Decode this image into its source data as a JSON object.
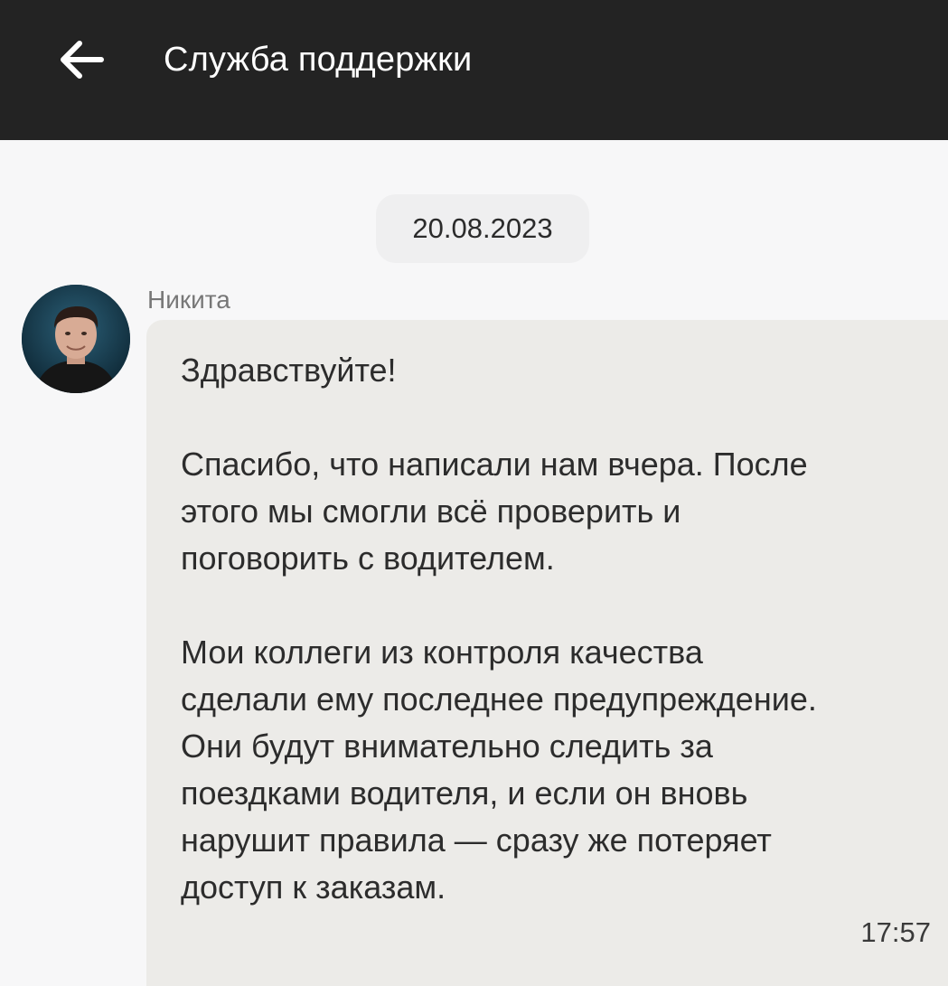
{
  "header": {
    "back_icon": "arrow-left-icon",
    "title": "Служба поддержки"
  },
  "chat": {
    "date": "20.08.2023",
    "message": {
      "sender": "Никита",
      "avatar": "avatar-photo",
      "text": "Здравствуйте!\n\nСпасибо, что написали нам вчера. После\nэтого мы смогли всё проверить и\nпоговорить с водителем.\n\nМои коллеги из контроля качества\nсделали ему последнее предупреждение.\nОни будут внимательно следить за\nпоездками водителя, и если он вновь\nнарушит правила — сразу же потеряет\nдоступ к заказам.",
      "time": "17:57"
    }
  },
  "colors": {
    "header_bg": "#232323",
    "page_bg": "#f7f7f8",
    "bubble_bg": "#ecebe8",
    "date_chip_bg": "#efeff0"
  }
}
